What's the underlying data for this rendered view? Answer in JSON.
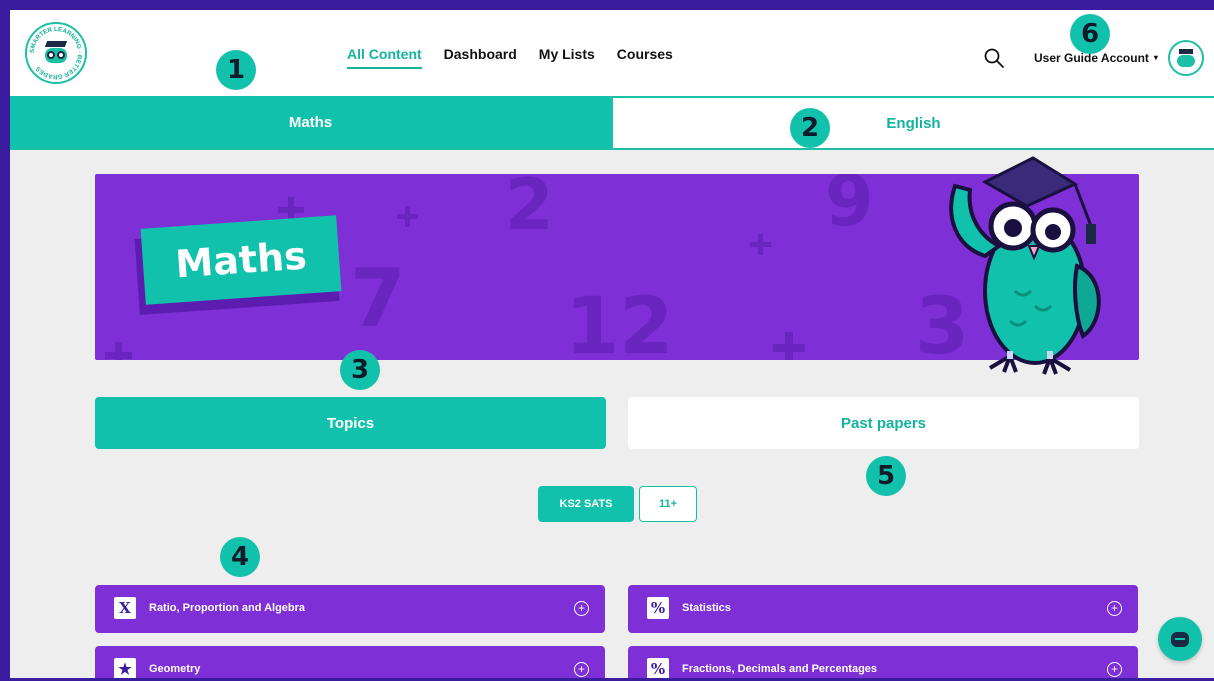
{
  "header": {
    "logo_text": "SMARTER LEARNING · BETTER GRADES",
    "nav": [
      {
        "label": "All Content",
        "active": true
      },
      {
        "label": "Dashboard",
        "active": false
      },
      {
        "label": "My Lists",
        "active": false
      },
      {
        "label": "Courses",
        "active": false
      }
    ],
    "search_icon": "search-icon",
    "account_label": "User Guide Account",
    "account_caret": "▾"
  },
  "subject_tabs": [
    {
      "label": "Maths",
      "active": true
    },
    {
      "label": "English",
      "active": false
    }
  ],
  "banner": {
    "title": "Maths",
    "bg_numbers": [
      "2",
      "9",
      "7",
      "12",
      "3"
    ]
  },
  "section_tabs": [
    {
      "label": "Topics",
      "active": true
    },
    {
      "label": "Past papers",
      "active": false
    }
  ],
  "filters": [
    {
      "label": "KS2 SATS",
      "active": true
    },
    {
      "label": "11+",
      "active": false
    }
  ],
  "markers": [
    "1",
    "2",
    "3",
    "4",
    "5",
    "6"
  ],
  "topics": [
    {
      "label": "Ratio, Proportion and Algebra",
      "icon": "x-variable-icon",
      "glyph": "X"
    },
    {
      "label": "Statistics",
      "icon": "percent-icon",
      "glyph": "%"
    },
    {
      "label": "Geometry",
      "icon": "star-icon",
      "glyph": "★"
    },
    {
      "label": "Fractions, Decimals and Percentages",
      "icon": "percent-icon",
      "glyph": "%"
    }
  ],
  "colors": {
    "teal": "#12c1ab",
    "purple": "#7e2fd6",
    "frame": "#3a1d9e"
  }
}
